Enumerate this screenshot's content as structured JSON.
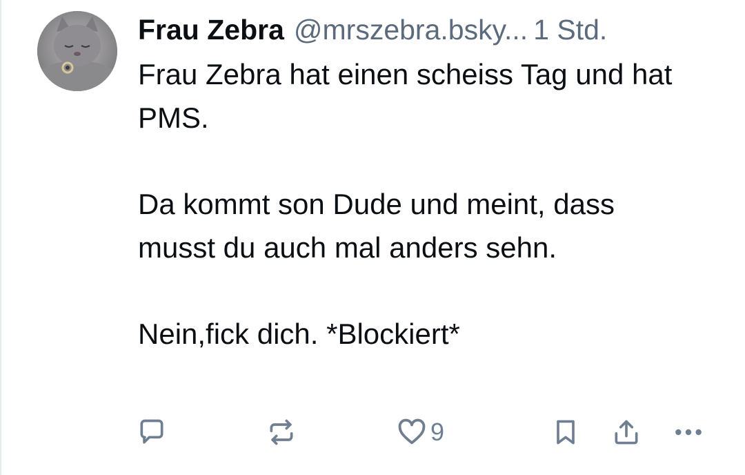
{
  "post": {
    "author": {
      "display_name": "Frau Zebra",
      "handle": "@mrszebra.bsky...",
      "avatar_icon": "cat-avatar"
    },
    "timestamp": "1 Std.",
    "paragraphs": [
      "Frau Zebra hat einen scheiss Tag und hat PMS.",
      "Da kommt son Dude und meint, dass musst du auch mal anders sehn.",
      "Nein,fick dich. *Blockiert*"
    ],
    "actions": {
      "reply_icon": "speech-bubble-icon",
      "repost_icon": "repost-icon",
      "like_icon": "heart-icon",
      "like_count": "9",
      "bookmark_icon": "bookmark-icon",
      "share_icon": "share-icon",
      "more_icon": "ellipsis-icon"
    }
  },
  "colors": {
    "text": "#0b0f14",
    "muted": "#5b6b7c",
    "icon": "#6f7f91",
    "divider": "#e6e9ee"
  }
}
